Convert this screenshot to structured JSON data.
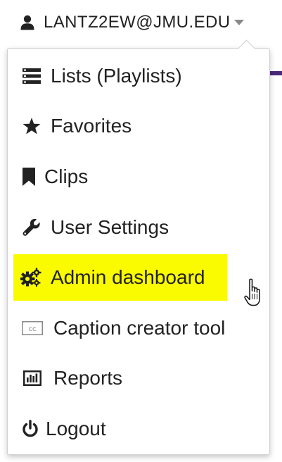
{
  "account": {
    "email": "LANTZ2EW@JMU.EDU",
    "user_icon": "user-icon",
    "caret_icon": "caret-down-icon"
  },
  "menu": {
    "items": [
      {
        "label": "Lists (Playlists)",
        "icon": "list-icon"
      },
      {
        "label": "Favorites",
        "icon": "star-icon"
      },
      {
        "label": "Clips",
        "icon": "bookmark-icon"
      },
      {
        "label": "User Settings",
        "icon": "wrench-icon"
      },
      {
        "label": "Admin dashboard",
        "icon": "gears-icon",
        "highlighted": true
      },
      {
        "label": "Caption creator tool",
        "icon": "closed-caption-icon"
      },
      {
        "label": "Reports",
        "icon": "bar-chart-icon"
      },
      {
        "label": "Logout",
        "icon": "power-icon"
      }
    ]
  },
  "colors": {
    "highlight": "#fbfb00",
    "text": "#222222",
    "nav_accent": "#4b2a7a"
  },
  "cursor": "hand-pointer-cursor"
}
